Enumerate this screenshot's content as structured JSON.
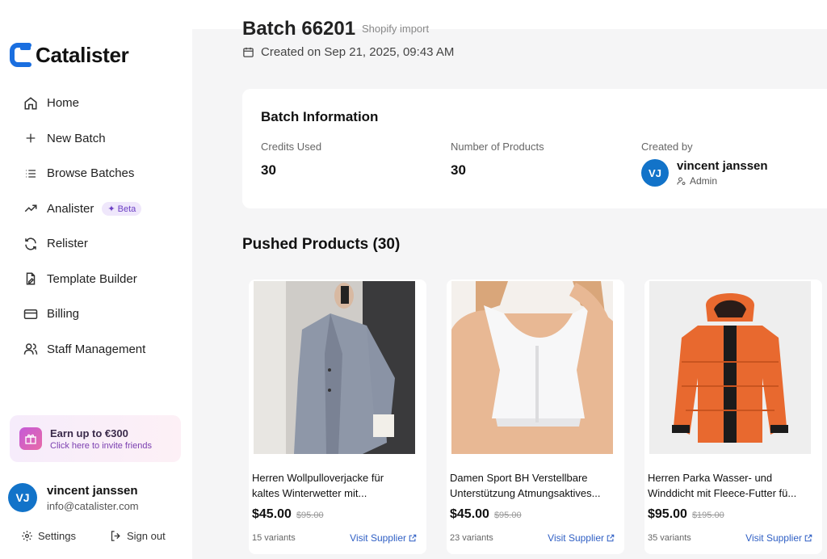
{
  "app": {
    "name": "Catalister"
  },
  "sidebar": {
    "items": [
      {
        "label": "Home",
        "icon": "home-icon"
      },
      {
        "label": "New Batch",
        "icon": "plus-icon"
      },
      {
        "label": "Browse Batches",
        "icon": "list-icon"
      },
      {
        "label": "Analister",
        "icon": "trending-icon",
        "badge": "✦ Beta"
      },
      {
        "label": "Relister",
        "icon": "refresh-icon"
      },
      {
        "label": "Template Builder",
        "icon": "file-pen-icon"
      },
      {
        "label": "Billing",
        "icon": "credit-card-icon"
      },
      {
        "label": "Staff Management",
        "icon": "users-icon"
      }
    ],
    "promo": {
      "title": "Earn up to €300",
      "subtitle": "Click here to invite friends"
    },
    "user": {
      "initials": "VJ",
      "name": "vincent janssen",
      "email": "info@catalister.com"
    },
    "settings_label": "Settings",
    "signout_label": "Sign out"
  },
  "batch": {
    "title": "Batch 66201",
    "source": "Shopify import",
    "created": "Created on Sep 21, 2025, 09:43 AM"
  },
  "info": {
    "title": "Batch Information",
    "credits_label": "Credits Used",
    "credits_value": "30",
    "products_label": "Number of Products",
    "products_value": "30",
    "created_by_label": "Created by",
    "creator_initials": "VJ",
    "creator_name": "vincent janssen",
    "creator_role": "Admin"
  },
  "pushed_title": "Pushed Products (30)",
  "products": [
    {
      "title_line1": "Herren Wollpulloverjacke für",
      "title_line2": "kaltes Winterwetter mit...",
      "price": "$45.00",
      "old_price": "$95.00",
      "variants": "15 variants",
      "link": "Visit Supplier"
    },
    {
      "title_line1": "Damen Sport BH Verstellbare",
      "title_line2": "Unterstützung Atmungsaktives...",
      "price": "$45.00",
      "old_price": "$95.00",
      "variants": "23 variants",
      "link": "Visit Supplier"
    },
    {
      "title_line1": "Herren Parka Wasser- und",
      "title_line2": "Winddicht mit Fleece-Futter fü...",
      "price": "$95.00",
      "old_price": "$195.00",
      "variants": "35 variants",
      "link": "Visit Supplier"
    }
  ],
  "colors": {
    "accent": "#1273c9",
    "link": "#2f5fc4",
    "beta_bg": "#efe7fb",
    "beta_text": "#6b3fc4",
    "jacket": "#e8692f"
  }
}
